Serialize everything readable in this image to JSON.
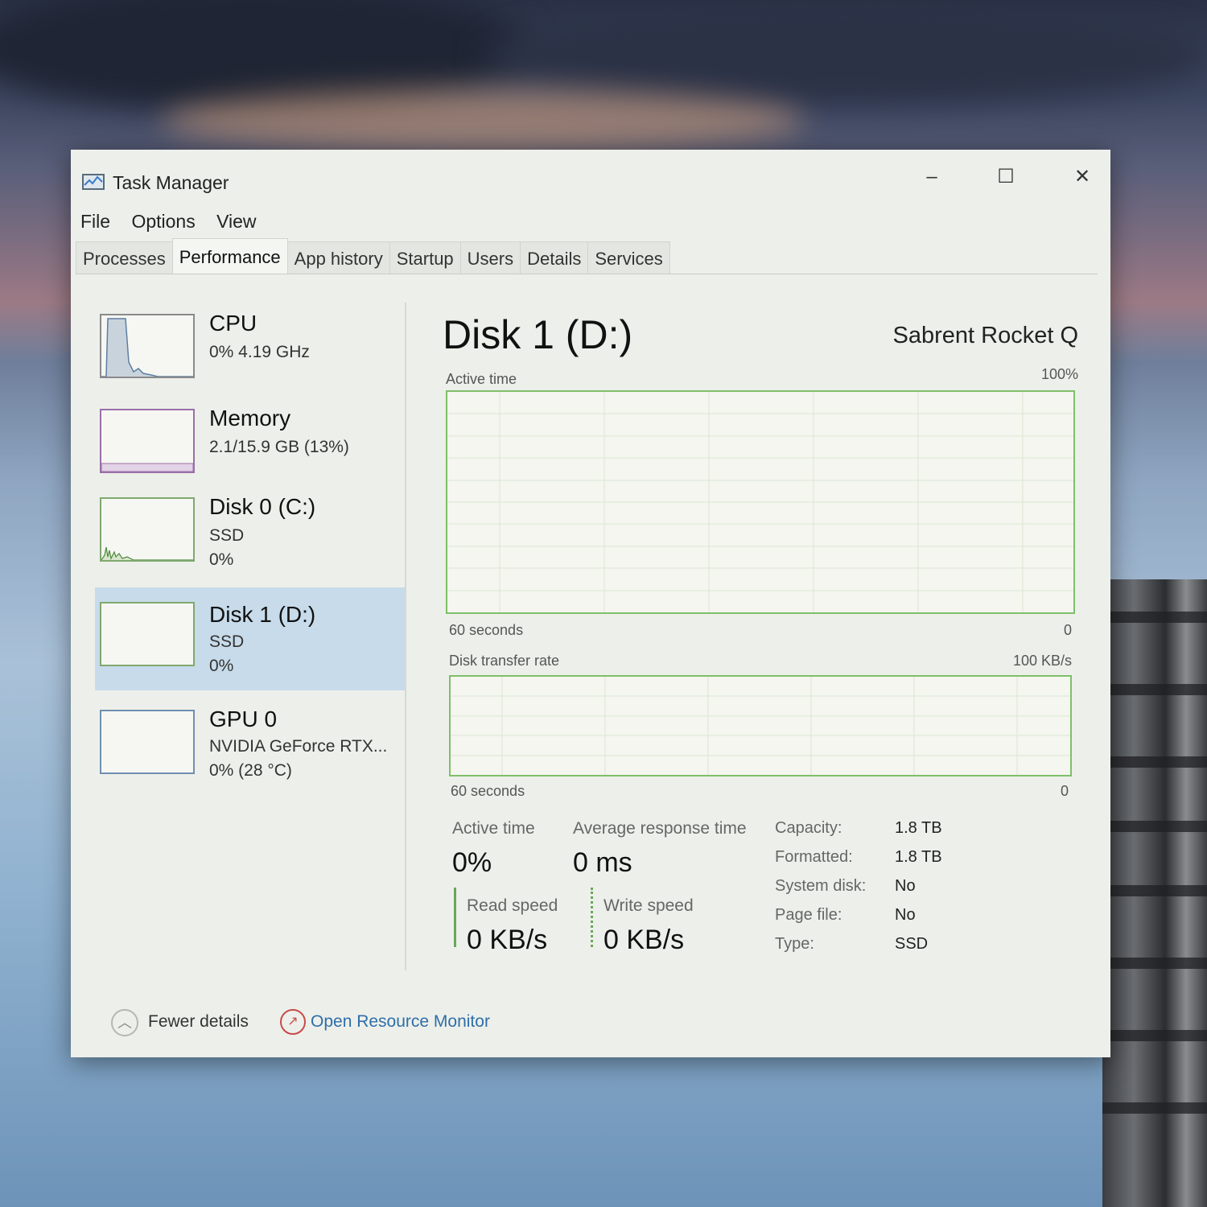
{
  "window": {
    "title": "Task Manager",
    "controls": {
      "minimize": "–",
      "maximize": "☐",
      "close": "✕"
    }
  },
  "menu": {
    "file": "File",
    "options": "Options",
    "view": "View"
  },
  "tabs": [
    "Processes",
    "Performance",
    "App history",
    "Startup",
    "Users",
    "Details",
    "Services"
  ],
  "active_tab": "Performance",
  "sidebar": {
    "cpu": {
      "name": "CPU",
      "line1": "0%  4.19 GHz"
    },
    "memory": {
      "name": "Memory",
      "line1": "2.1/15.9 GB (13%)"
    },
    "disk0": {
      "name": "Disk 0 (C:)",
      "line1": "SSD",
      "line2": "0%"
    },
    "disk1": {
      "name": "Disk 1 (D:)",
      "line1": "SSD",
      "line2": "0%"
    },
    "gpu0": {
      "name": "GPU 0",
      "line1": "NVIDIA GeForce RTX...",
      "line2": "0%  (28 °C)"
    }
  },
  "detail": {
    "title": "Disk 1 (D:)",
    "model": "Sabrent Rocket Q",
    "graph1": {
      "label": "Active time",
      "max": "100%",
      "span": "60 seconds",
      "min": "0"
    },
    "graph2": {
      "label": "Disk transfer rate",
      "max": "100 KB/s",
      "span": "60 seconds",
      "min": "0"
    },
    "stats": {
      "active_time_label": "Active time",
      "active_time_value": "0%",
      "avg_resp_label": "Average response time",
      "avg_resp_value": "0 ms",
      "read_label": "Read speed",
      "read_value": "0 KB/s",
      "write_label": "Write speed",
      "write_value": "0 KB/s"
    },
    "properties": [
      {
        "label": "Capacity:",
        "value": "1.8 TB"
      },
      {
        "label": "Formatted:",
        "value": "1.8 TB"
      },
      {
        "label": "System disk:",
        "value": "No"
      },
      {
        "label": "Page file:",
        "value": "No"
      },
      {
        "label": "Type:",
        "value": "SSD"
      }
    ]
  },
  "footer": {
    "fewer_details": "Fewer details",
    "open_resource_monitor": "Open Resource Monitor"
  },
  "colors": {
    "accent_green": "#6aa659",
    "selection": "#c7dbea",
    "link": "#2f6ea9"
  }
}
